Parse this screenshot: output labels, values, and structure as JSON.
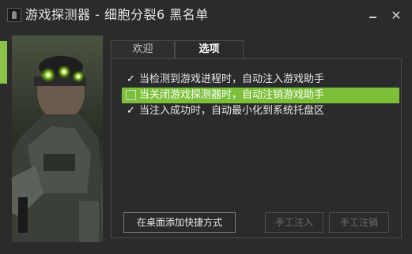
{
  "window": {
    "title": "游戏探测器 - 细胞分裂6 黑名单",
    "minimize_label": "",
    "close_label": "✕"
  },
  "colors": {
    "accent": "#8bc34a",
    "highlight": "#7cc03a",
    "background": "#2b2b2b"
  },
  "portrait": {
    "icon": "game-cover-art"
  },
  "tabs": [
    {
      "label": "欢迎",
      "active": false
    },
    {
      "label": "选项",
      "active": true
    }
  ],
  "options": [
    {
      "label": "当检测到游戏进程时，自动注入游戏助手",
      "checked": true,
      "highlighted": false
    },
    {
      "label": "当关闭游戏探测器时，自动注销游戏助手",
      "checked": false,
      "highlighted": true
    },
    {
      "label": "当注入成功时，自动最小化到系统托盘区",
      "checked": true,
      "highlighted": false
    }
  ],
  "buttons": {
    "add_shortcut": "在桌面添加快捷方式",
    "manual_inject": "手工注入",
    "manual_uninject": "手工注销"
  }
}
